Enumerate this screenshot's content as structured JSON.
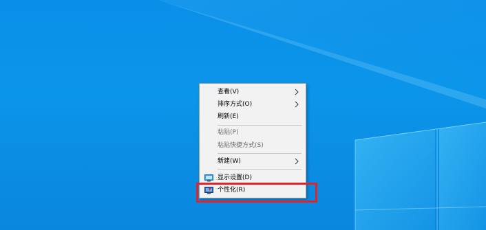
{
  "colors": {
    "wallpaper": "#0a8fe8",
    "menu_background": "#f2f2f2",
    "disabled_text": "#6d6d6d",
    "highlight_border": "#e0242b"
  },
  "context_menu": {
    "items": [
      {
        "label": "查看(V)",
        "has_submenu": true,
        "disabled": false
      },
      {
        "label": "排序方式(O)",
        "has_submenu": true,
        "disabled": false
      },
      {
        "label": "刷新(E)",
        "has_submenu": false,
        "disabled": false
      },
      {
        "label": "粘贴(P)",
        "has_submenu": false,
        "disabled": true
      },
      {
        "label": "粘贴快捷方式(S)",
        "has_submenu": false,
        "disabled": true
      },
      {
        "label": "新建(W)",
        "has_submenu": true,
        "disabled": false
      },
      {
        "label": "显示设置(D)",
        "has_submenu": false,
        "disabled": false,
        "icon": "display-icon"
      },
      {
        "label": "个性化(R)",
        "has_submenu": false,
        "disabled": false,
        "icon": "personalize-icon"
      }
    ]
  }
}
